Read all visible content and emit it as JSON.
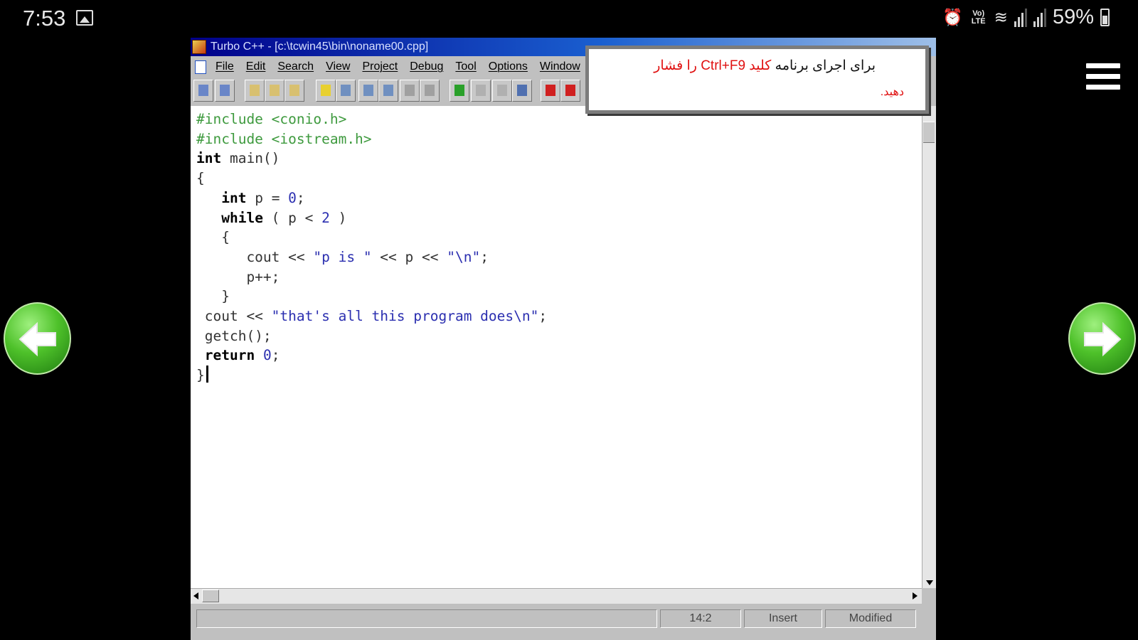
{
  "status_bar": {
    "time": "7:53",
    "volte_label": "Vo) LTE",
    "battery": "59%"
  },
  "window": {
    "title": "Turbo C++ - [c:\\tcwin45\\bin\\noname00.cpp]",
    "menu": [
      "File",
      "Edit",
      "Search",
      "View",
      "Project",
      "Debug",
      "Tool",
      "Options",
      "Window"
    ],
    "toolbar_icons": [
      "undo-icon",
      "redo-icon",
      "new-file-icon",
      "open-file-icon",
      "save-file-icon",
      "compile-icon",
      "make-icon",
      "build-icon",
      "build-all-icon",
      "cut-icon",
      "copy-icon",
      "run-icon",
      "step-over-icon",
      "trace-into-icon",
      "inspect-icon",
      "breakpoint-icon",
      "watch-icon"
    ],
    "code": [
      [
        {
          "t": "#include <conio.h>",
          "c": "pp"
        }
      ],
      [
        {
          "t": "#include <iostream.h>",
          "c": "pp"
        }
      ],
      [
        {
          "t": "int",
          "c": "kw"
        },
        {
          "t": " main()",
          "c": ""
        }
      ],
      [
        {
          "t": "{",
          "c": ""
        }
      ],
      [
        {
          "t": "   ",
          "c": ""
        },
        {
          "t": "int",
          "c": "kw"
        },
        {
          "t": " p = ",
          "c": ""
        },
        {
          "t": "0",
          "c": "num"
        },
        {
          "t": ";",
          "c": ""
        }
      ],
      [
        {
          "t": "   ",
          "c": ""
        },
        {
          "t": "while",
          "c": "kw"
        },
        {
          "t": " ( p < ",
          "c": ""
        },
        {
          "t": "2",
          "c": "num"
        },
        {
          "t": " )",
          "c": ""
        }
      ],
      [
        {
          "t": "   {",
          "c": ""
        }
      ],
      [
        {
          "t": "      cout << ",
          "c": ""
        },
        {
          "t": "\"p is \"",
          "c": "str"
        },
        {
          "t": " << p << ",
          "c": ""
        },
        {
          "t": "\"\\n\"",
          "c": "str"
        },
        {
          "t": ";",
          "c": ""
        }
      ],
      [
        {
          "t": "      p++;",
          "c": ""
        }
      ],
      [
        {
          "t": "   }",
          "c": ""
        }
      ],
      [
        {
          "t": " cout << ",
          "c": ""
        },
        {
          "t": "\"that's all this program does\\n\"",
          "c": "str"
        },
        {
          "t": ";",
          "c": ""
        }
      ],
      [
        {
          "t": " getch();",
          "c": ""
        }
      ],
      [
        {
          "t": " ",
          "c": ""
        },
        {
          "t": "return",
          "c": "kw"
        },
        {
          "t": " ",
          "c": ""
        },
        {
          "t": "0",
          "c": "num"
        },
        {
          "t": ";",
          "c": ""
        }
      ],
      [
        {
          "t": "}",
          "c": ""
        }
      ]
    ],
    "status": {
      "position": "14:2",
      "mode": "Insert",
      "modified": "Modified"
    }
  },
  "tooltip": {
    "part1": "برای اجرای برنامه ",
    "part2": "کلید ",
    "key": "Ctrl+F9",
    "part3": " را فشار",
    "line2": "دهید."
  },
  "nav": {
    "prev_icon": "arrow-left-icon",
    "next_icon": "arrow-right-icon",
    "menu_icon": "hamburger-menu-icon"
  },
  "colors": {
    "preprocessor": "#3e9a3e",
    "string_literal": "#2b2fb0",
    "tooltip_highlight": "#e01010",
    "nav_button": "#4ec12a"
  }
}
